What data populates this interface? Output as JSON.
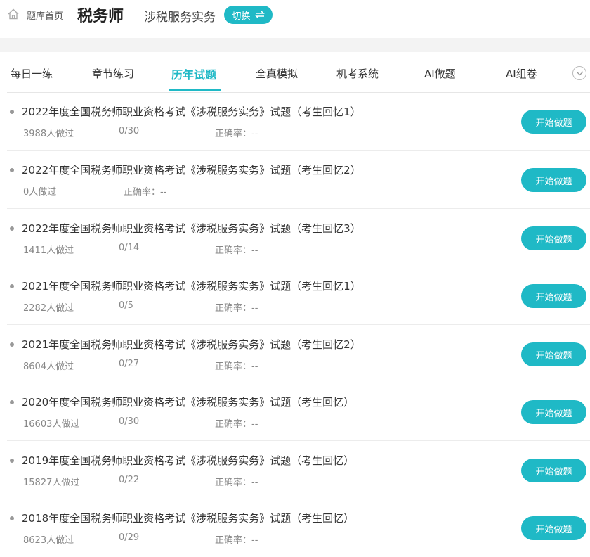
{
  "header": {
    "breadcrumb": "题库首页",
    "exam_name": "税务师",
    "subject": "涉税服务实务",
    "switch_label": "切换"
  },
  "tabs": [
    {
      "label": "每日一练",
      "active": false
    },
    {
      "label": "章节练习",
      "active": false
    },
    {
      "label": "历年试题",
      "active": true
    },
    {
      "label": "全真模拟",
      "active": false
    },
    {
      "label": "机考系统",
      "active": false
    },
    {
      "label": "AI做题",
      "active": false
    },
    {
      "label": "AI组卷",
      "active": false
    }
  ],
  "accent_color": "#1fb9c6",
  "papers": [
    {
      "title": "2022年度全国税务师职业资格考试《涉税服务实务》试题（考生回忆1）",
      "done": "3988人做过",
      "progress": "0/30",
      "accuracy": "正确率：--",
      "button": "开始做题"
    },
    {
      "title": "2022年度全国税务师职业资格考试《涉税服务实务》试题（考生回忆2）",
      "done": "0人做过",
      "progress": "",
      "accuracy": "正确率：--",
      "button": "开始做题"
    },
    {
      "title": "2022年度全国税务师职业资格考试《涉税服务实务》试题（考生回忆3）",
      "done": "1411人做过",
      "progress": "0/14",
      "accuracy": "正确率：--",
      "button": "开始做题"
    },
    {
      "title": "2021年度全国税务师职业资格考试《涉税服务实务》试题（考生回忆1）",
      "done": "2282人做过",
      "progress": "0/5",
      "accuracy": "正确率：--",
      "button": "开始做题"
    },
    {
      "title": "2021年度全国税务师职业资格考试《涉税服务实务》试题（考生回忆2）",
      "done": "8604人做过",
      "progress": "0/27",
      "accuracy": "正确率：--",
      "button": "开始做题"
    },
    {
      "title": "2020年度全国税务师职业资格考试《涉税服务实务》试题（考生回忆）",
      "done": "16603人做过",
      "progress": "0/30",
      "accuracy": "正确率：--",
      "button": "开始做题"
    },
    {
      "title": "2019年度全国税务师职业资格考试《涉税服务实务》试题（考生回忆）",
      "done": "15827人做过",
      "progress": "0/22",
      "accuracy": "正确率：--",
      "button": "开始做题"
    },
    {
      "title": "2018年度全国税务师职业资格考试《涉税服务实务》试题（考生回忆）",
      "done": "8623人做过",
      "progress": "0/29",
      "accuracy": "正确率：--",
      "button": "开始做题"
    }
  ]
}
